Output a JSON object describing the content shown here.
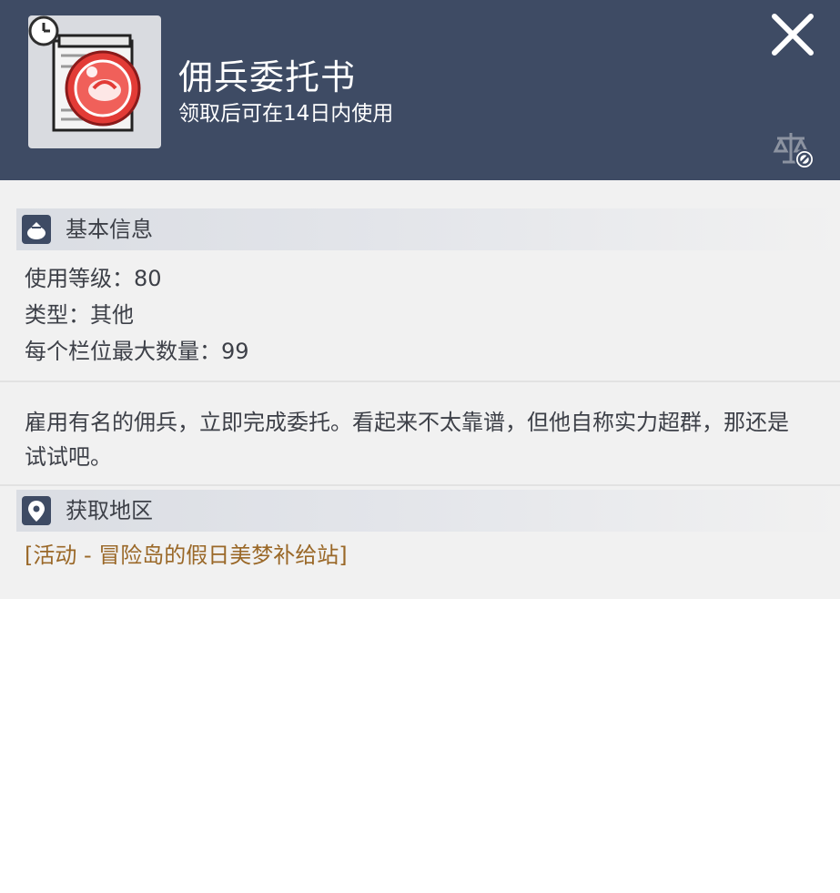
{
  "header": {
    "item_name": "佣兵委托书",
    "item_sub": "领取后可在14日内使用",
    "close_icon": "close-icon",
    "trade_icon": "trade-restricted-icon",
    "item_icon": "mercenary-contract-icon",
    "badge_icon": "clock-icon"
  },
  "basic_info": {
    "title": "基本信息",
    "icon": "money-bag-icon",
    "lines": [
      "使用等级：80",
      "类型：其他",
      "每个栏位最大数量：99"
    ]
  },
  "description": "雇用有名的佣兵，立即完成委托。看起来不太靠谱，但他自称实力超群，那还是试试吧。",
  "acquire": {
    "title": "获取地区",
    "icon": "location-pin-icon",
    "location": "[活动 - 冒险岛的假日美梦补给站]"
  },
  "colors": {
    "header_bg": "#3e4b64",
    "body_bg": "#f1f1f1",
    "location_text": "#9a6828"
  }
}
